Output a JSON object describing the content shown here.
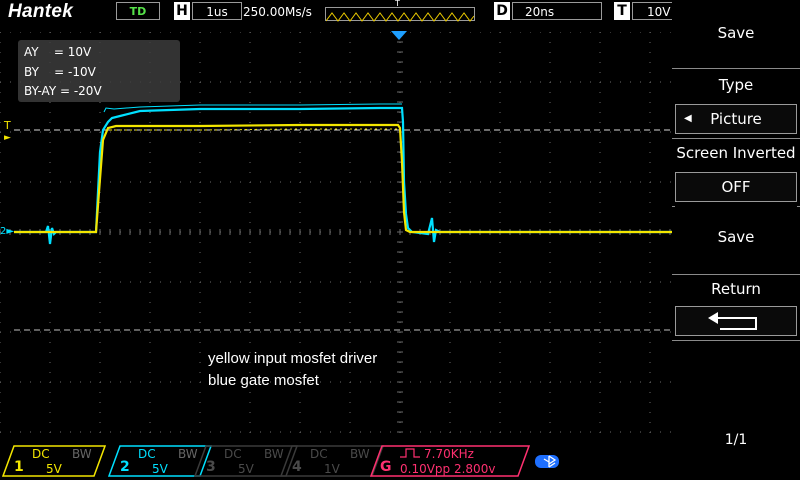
{
  "topbar": {
    "logo": "Hantek",
    "mode": "TD",
    "h_letter": "H",
    "timebase": "1us",
    "sample_rate": "250.00Ms/s",
    "trigger_t": "T",
    "d_letter": "D",
    "delay": "20ns",
    "t_letter": "T",
    "trigger_level": "10V"
  },
  "measurements": {
    "ay": "AY    = 10V",
    "by": "BY    = -10V",
    "by_ay": "BY-AY = -20V"
  },
  "annotation": {
    "line1": "yellow input mosfet driver",
    "line2": "blue gate mosfet"
  },
  "markers": {
    "trigger_level": "T",
    "ground": "2"
  },
  "menu": {
    "title": "Save",
    "type_label": "Type",
    "type_value": "Picture",
    "inverted_label": "Screen Inverted",
    "inverted_value": "OFF",
    "save_button": "Save",
    "return_label": "Return",
    "page": "1/1"
  },
  "channels": [
    {
      "num": "1",
      "coupling": "DC",
      "bw": "BW",
      "vdiv": "5V",
      "color": "#f3e600"
    },
    {
      "num": "2",
      "coupling": "DC",
      "bw": "BW",
      "vdiv": "5V",
      "color": "#00e0ff"
    },
    {
      "num": "3",
      "coupling": "DC",
      "bw": "BW",
      "vdiv": "5V",
      "color": "#4a4a4a"
    },
    {
      "num": "4",
      "coupling": "DC",
      "bw": "BW",
      "vdiv": "1V",
      "color": "#4a4a4a"
    }
  ],
  "generator": {
    "letter": "G",
    "frequency": "7.70KHz",
    "amplitude": "0.10Vpp 2.800v",
    "color": "#ff3070"
  },
  "colors": {
    "ch1": "#f3e600",
    "ch2": "#00e0ff",
    "trigger_marker": "#1e9fff",
    "grid": "#6a6a6a"
  },
  "icons": {
    "trigger_edge": "trigger-wave-icon",
    "return": "return-arrow-icon",
    "bluetooth": "bluetooth-icon"
  }
}
